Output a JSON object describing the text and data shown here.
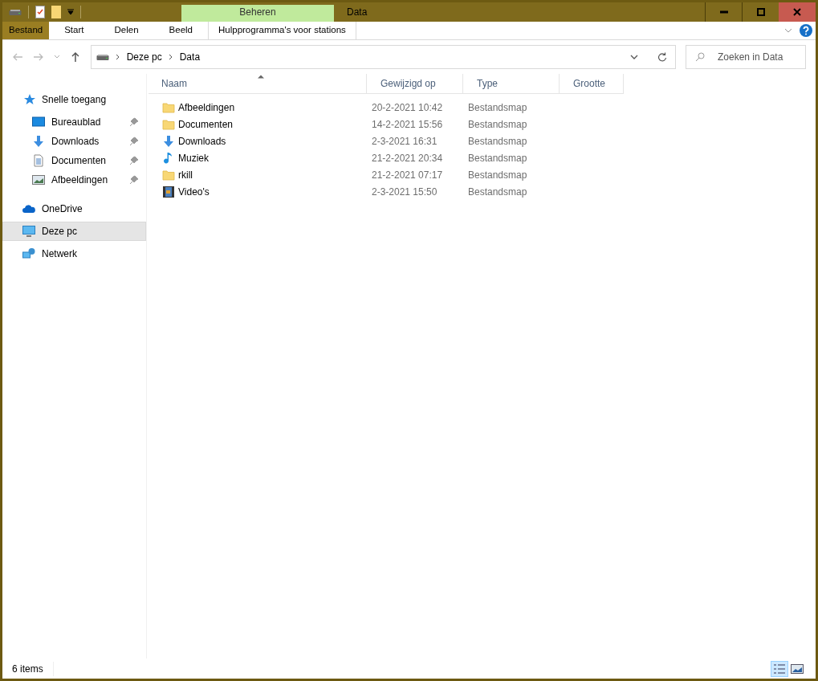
{
  "window": {
    "title": "Data",
    "context_tab": "Beheren"
  },
  "ribbon_tabs": [
    {
      "label": "Bestand",
      "selected": true
    },
    {
      "label": "Start",
      "selected": false
    },
    {
      "label": "Delen",
      "selected": false
    },
    {
      "label": "Beeld",
      "selected": false
    },
    {
      "label": "Hulpprogramma's voor stations",
      "selected": false
    }
  ],
  "breadcrumb": [
    "Deze pc",
    "Data"
  ],
  "search": {
    "placeholder": "Zoeken in Data"
  },
  "sidebar": {
    "items": [
      {
        "label": "Snelle toegang",
        "kind": "quick",
        "selected": false,
        "children": [
          {
            "label": "Bureaublad",
            "kind": "desktop",
            "pinned": true,
            "selected": false
          },
          {
            "label": "Downloads",
            "kind": "download",
            "pinned": true,
            "selected": false
          },
          {
            "label": "Documenten",
            "kind": "document",
            "pinned": true,
            "selected": false
          },
          {
            "label": "Afbeeldingen",
            "kind": "picture",
            "pinned": true,
            "selected": false
          }
        ]
      },
      {
        "label": "OneDrive",
        "kind": "cloud",
        "selected": false
      },
      {
        "label": "Deze pc",
        "kind": "pc",
        "selected": true
      },
      {
        "label": "Netwerk",
        "kind": "network",
        "selected": false
      }
    ]
  },
  "table": {
    "columns": [
      "Naam",
      "Gewijzigd op",
      "Type",
      "Grootte"
    ],
    "rows": [
      {
        "name": "Afbeeldingen",
        "kind": "folder",
        "modified": "20-2-2021 10:42",
        "type": "Bestandsmap"
      },
      {
        "name": "Documenten",
        "kind": "folder",
        "modified": "14-2-2021 15:56",
        "type": "Bestandsmap"
      },
      {
        "name": "Downloads",
        "kind": "download",
        "modified": "2-3-2021 16:31",
        "type": "Bestandsmap"
      },
      {
        "name": "Muziek",
        "kind": "music",
        "modified": "21-2-2021 20:34",
        "type": "Bestandsmap"
      },
      {
        "name": "rkill",
        "kind": "folder",
        "modified": "21-2-2021 07:17",
        "type": "Bestandsmap"
      },
      {
        "name": "Video's",
        "kind": "video",
        "modified": "2-3-2021 15:50",
        "type": "Bestandsmap"
      }
    ]
  },
  "status_bar": {
    "count": "6 items",
    "view_buttons": [
      {
        "kind": "details",
        "selected": true
      },
      {
        "kind": "icons",
        "selected": false
      }
    ]
  }
}
